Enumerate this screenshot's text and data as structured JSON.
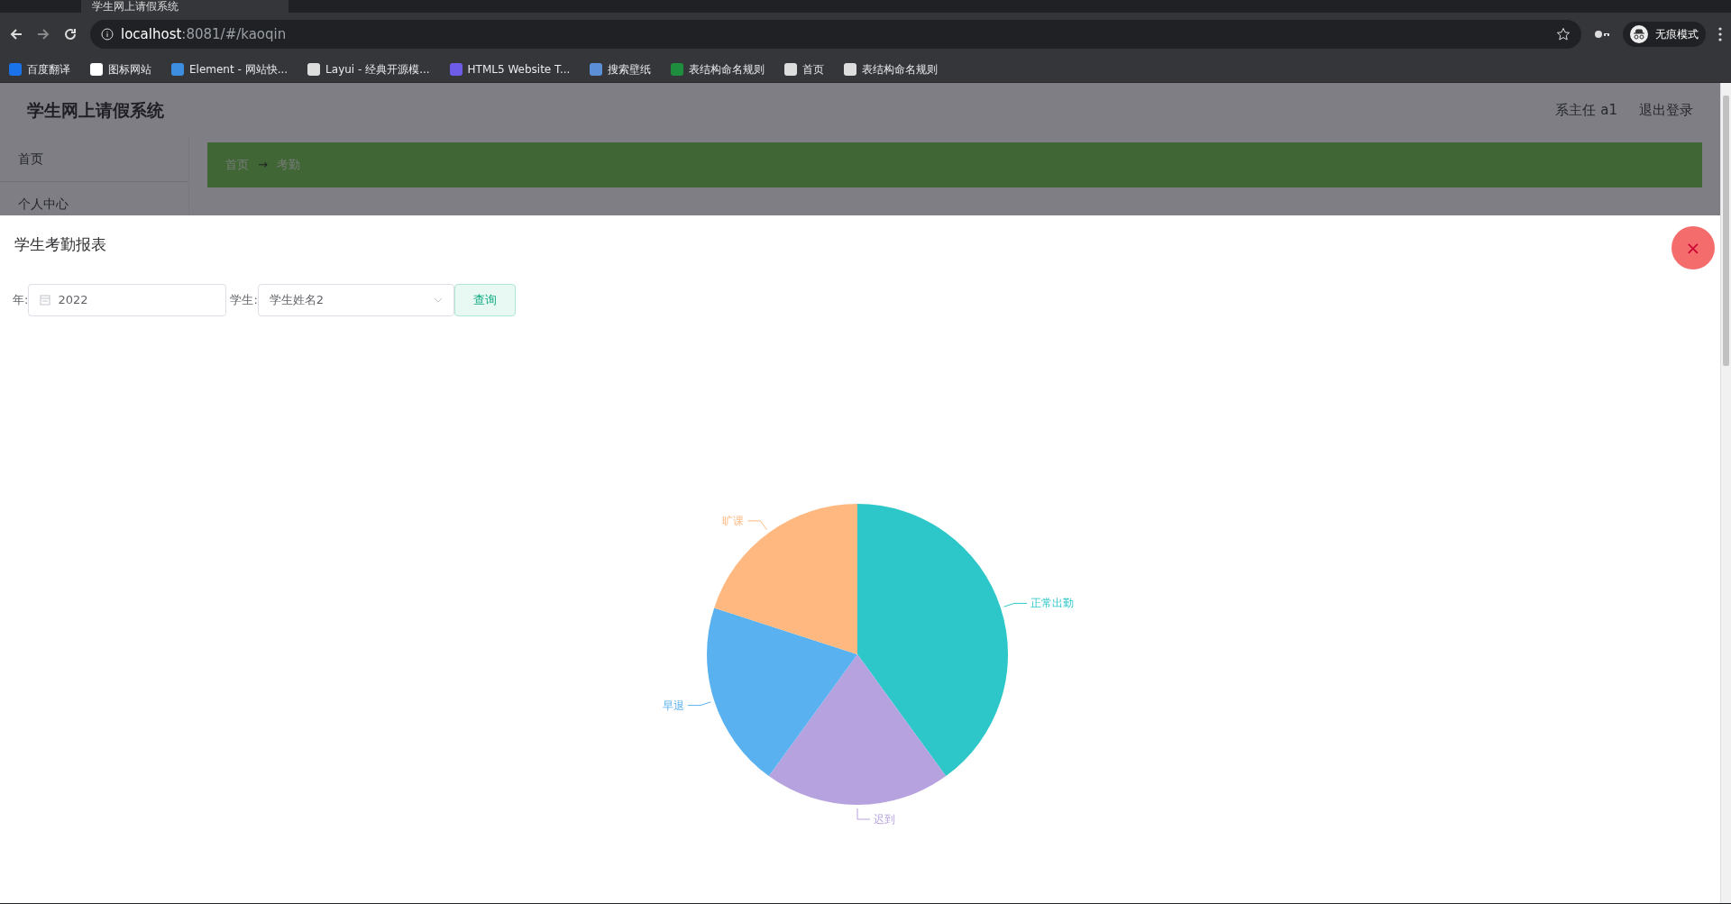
{
  "browser": {
    "tab_title": "学生网上请假系统",
    "url_host": "localhost",
    "url_rest": ":8081/#/kaoqin",
    "bookmarks": [
      "百度翻译",
      "图标网站",
      "Element - 网站快...",
      "Layui - 经典开源模...",
      "HTML5 Website T...",
      "搜索壁纸",
      "表结构命名规则",
      "首页",
      "表结构命名规则"
    ],
    "profile": "无痕模式"
  },
  "app": {
    "title": "学生网上请假系统",
    "user": "系主任 a1",
    "logout": "退出登录",
    "sidebar": [
      "首页",
      "个人中心"
    ],
    "breadcrumb": [
      "首页",
      "→",
      "考勤"
    ]
  },
  "modal": {
    "title": "学生考勤报表",
    "year_label": "年:",
    "year_value": "2022",
    "student_label": "学生:",
    "student_value": "学生姓名2",
    "query_button": "查询",
    "close_symbol": "×",
    "chart_data": {
      "type": "pie",
      "categories": [
        "正常出勤",
        "迟到",
        "早退",
        "旷课"
      ],
      "values": [
        40,
        20,
        20,
        20
      ],
      "colors": [
        "#2ec7c9",
        "#b6a2de",
        "#5ab1ef",
        "#ffb980"
      ]
    }
  }
}
